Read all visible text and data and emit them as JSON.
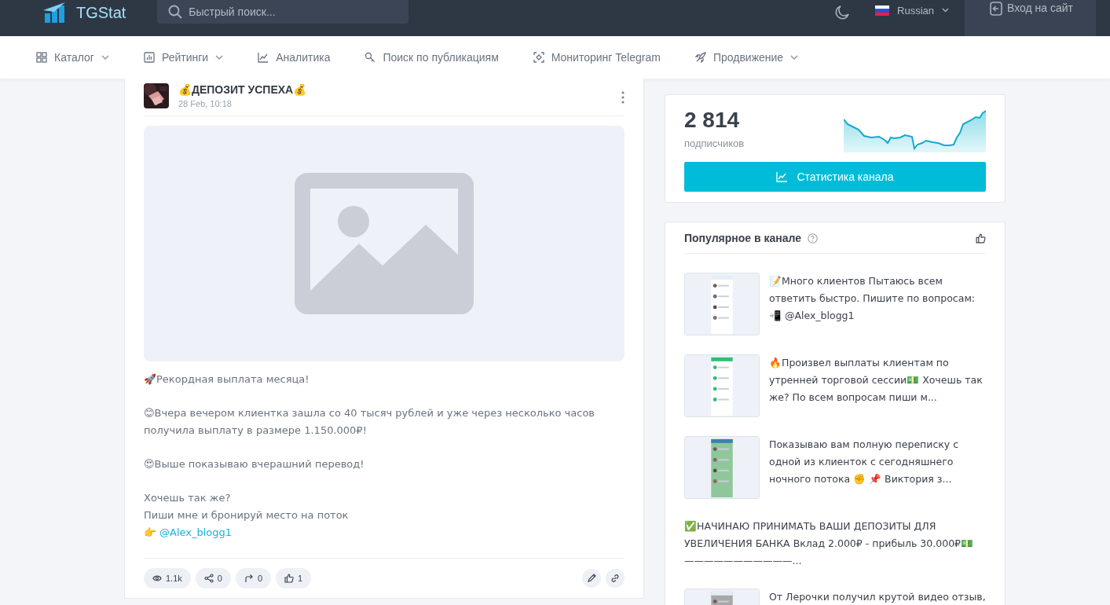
{
  "header": {
    "logo": "TGStat",
    "search": {
      "placeholder": "Быстрый поиск..."
    },
    "language": "Russian",
    "login": "Вход на сайт"
  },
  "nav": [
    {
      "label": "Каталог",
      "dropdown": true
    },
    {
      "label": "Рейтинги",
      "dropdown": true
    },
    {
      "label": "Аналитика",
      "dropdown": false
    },
    {
      "label": "Поиск по публикациям",
      "dropdown": false
    },
    {
      "label": "Мониторинг Telegram",
      "dropdown": false
    },
    {
      "label": "Продвижение",
      "dropdown": true
    }
  ],
  "post": {
    "channel": "💰ДЕПОЗИТ УСПЕХА💰",
    "date": "28 Feb, 10:18",
    "paragraphs": [
      [
        "🚀Рекордная выплата месяца!"
      ],
      [
        "😊Вчера вечером клиентка зашла со 40 тысяч рублей и уже через несколько часов получила выплату в размере 1.150.000₽!"
      ],
      [
        "😍Выше показываю вчерашний перевод!"
      ],
      [
        "Хочешь так же?",
        "Пиши мне и бронируй место на поток"
      ]
    ],
    "mention": {
      "prefix": "👉",
      "link": "@Alex_blogg1"
    },
    "stats": [
      {
        "kind": "views",
        "value": "1.1k"
      },
      {
        "kind": "shares",
        "value": "0"
      },
      {
        "kind": "forwards",
        "value": "0"
      },
      {
        "kind": "reactions",
        "value": "1"
      }
    ]
  },
  "subscribers": {
    "count": "2 814",
    "label": "подписчиков",
    "button": "Статистика канала"
  },
  "popular": {
    "title": "Популярное в канале",
    "items": [
      {
        "kind": "with_picture",
        "text": "📝Много клиентов Пытаюсь всем ответить быстро. Пишите по вопросам: 📲 @Alex_blogg1"
      },
      {
        "kind": "with_picture",
        "text": "🔥Произвел выплаты клиентам по утренней торговой сессии💵 Хочешь так же? По всем вопросам пиши м..."
      },
      {
        "kind": "with_picture",
        "text": "Показываю вам полную переписку с одной из клиенток с сегодняшнего ночного потока ✊ 📌 Виктория з..."
      },
      {
        "kind": "text_only",
        "text": "✅НАЧИНАЮ ПРИНИМАТЬ ВАШИ ДЕПОЗИТЫ ДЛЯ УВЕЛИЧЕНИЯ БАНКА Вклад 2.000₽ - прибыль 30.000₽💵 ———————————..."
      },
      {
        "kind": "with_picture",
        "text": "От Лерочки получил крутой видео отзыв,"
      }
    ]
  }
}
